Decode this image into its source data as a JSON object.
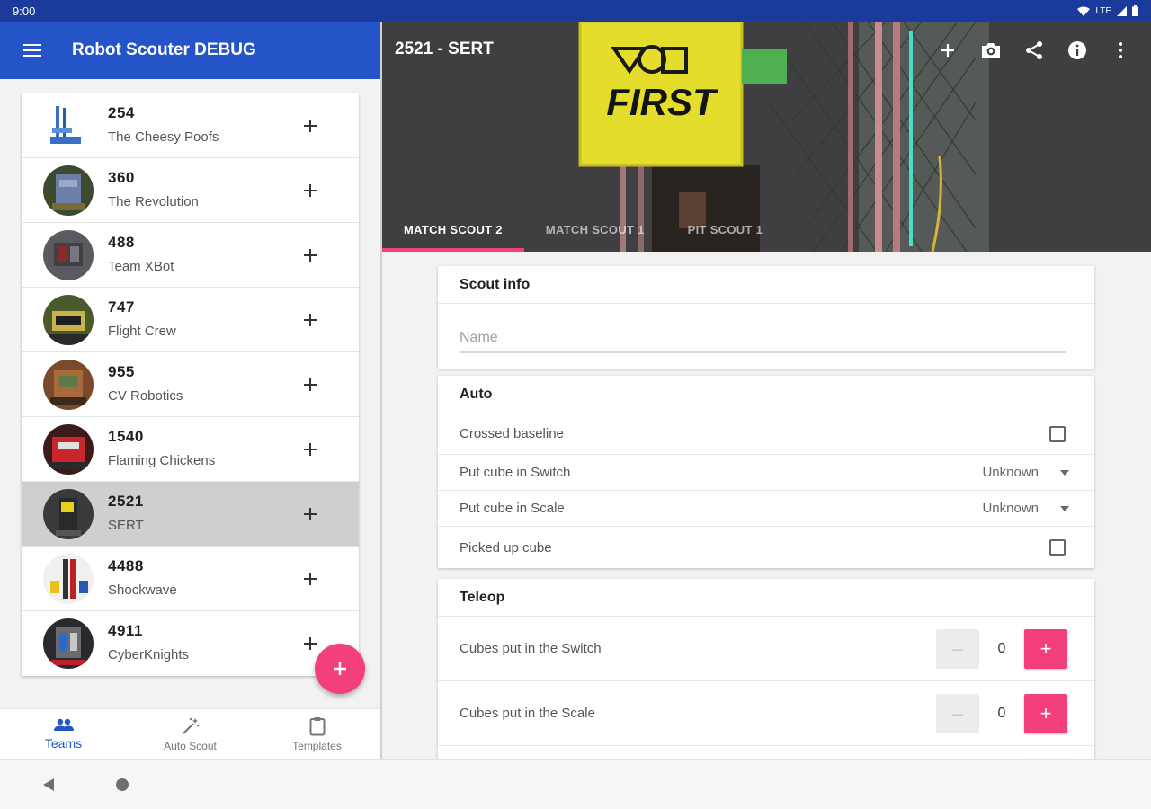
{
  "status_bar": {
    "time": "9:00",
    "network": "LTE"
  },
  "app_bar": {
    "title": "Robot Scouter DEBUG",
    "menu_icon": "menu-icon"
  },
  "teams": [
    {
      "number": "254",
      "name": "The Cheesy Poofs"
    },
    {
      "number": "360",
      "name": "The Revolution"
    },
    {
      "number": "488",
      "name": "Team XBot"
    },
    {
      "number": "747",
      "name": "Flight Crew"
    },
    {
      "number": "955",
      "name": "CV Robotics"
    },
    {
      "number": "1540",
      "name": "Flaming Chickens"
    },
    {
      "number": "2521",
      "name": "SERT",
      "selected": true
    },
    {
      "number": "4488",
      "name": "Shockwave"
    },
    {
      "number": "4911",
      "name": "CyberKnights"
    }
  ],
  "bottom_nav": {
    "items": [
      {
        "label": "Teams",
        "icon": "people-icon",
        "active": true
      },
      {
        "label": "Auto Scout",
        "icon": "magic-wand-icon",
        "active": false
      },
      {
        "label": "Templates",
        "icon": "clipboard-icon",
        "active": false
      }
    ]
  },
  "detail": {
    "title": "2521 - SERT",
    "actions": [
      "add-icon",
      "camera-icon",
      "share-icon",
      "info-icon",
      "more-vert-icon"
    ],
    "tabs": [
      {
        "label": "MATCH SCOUT 2",
        "active": true
      },
      {
        "label": "MATCH SCOUT 1",
        "active": false
      },
      {
        "label": "PIT SCOUT 1",
        "active": false
      }
    ],
    "scout_info": {
      "header": "Scout info",
      "name_placeholder": "Name",
      "name_value": ""
    },
    "auto": {
      "header": "Auto",
      "crossed_baseline": {
        "label": "Crossed baseline",
        "checked": false
      },
      "switch_cube": {
        "label": "Put cube in Switch",
        "value": "Unknown"
      },
      "scale_cube": {
        "label": "Put cube in Scale",
        "value": "Unknown"
      },
      "picked_up_cube": {
        "label": "Picked up cube",
        "checked": false
      }
    },
    "teleop": {
      "header": "Teleop",
      "switch_counter": {
        "label": "Cubes put in the Switch",
        "value": "0"
      },
      "scale_counter": {
        "label": "Cubes put in the Scale",
        "value": "0"
      }
    }
  },
  "header_image_text": "FIRST",
  "colors": {
    "primary": "#2454c8",
    "status": "#1a3a9c",
    "accent": "#f43f7f"
  }
}
